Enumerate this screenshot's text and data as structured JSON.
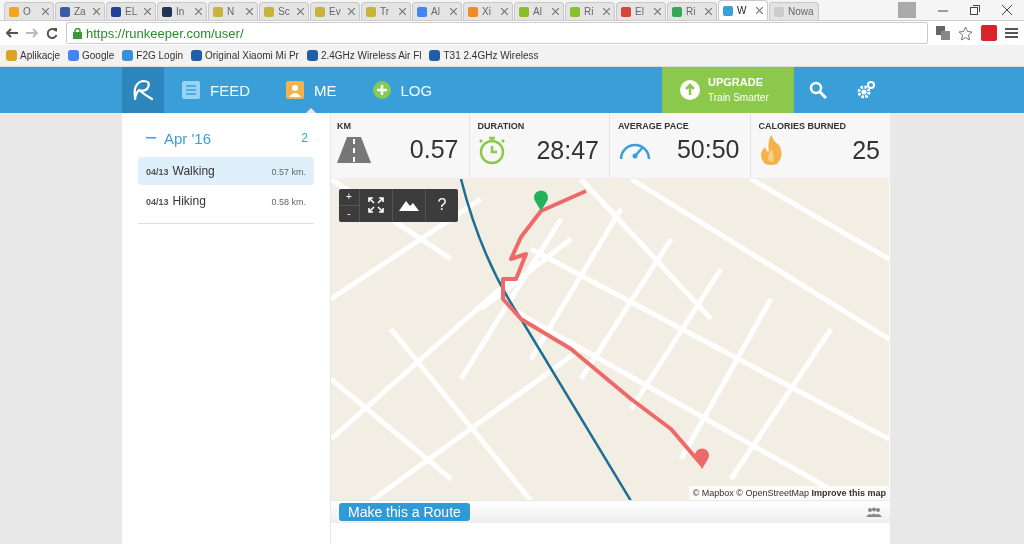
{
  "browser": {
    "tabs": [
      {
        "title": "O",
        "color": "#f4a323",
        "selected": false
      },
      {
        "title": "Za",
        "color": "#3b5ba9",
        "selected": false
      },
      {
        "title": "EL",
        "color": "#1f3f9a",
        "selected": false
      },
      {
        "title": "In",
        "color": "#223355",
        "selected": false
      },
      {
        "title": "N",
        "color": "#c8b43a",
        "selected": false
      },
      {
        "title": "Sc",
        "color": "#c8b43a",
        "selected": false
      },
      {
        "title": "Ev",
        "color": "#c8b43a",
        "selected": false
      },
      {
        "title": "Tr",
        "color": "#c8b43a",
        "selected": false
      },
      {
        "title": "Al",
        "color": "#4285f4",
        "selected": false
      },
      {
        "title": "Xi",
        "color": "#f08a24",
        "selected": false
      },
      {
        "title": "Al",
        "color": "#8bbf2a",
        "selected": false
      },
      {
        "title": "Ri",
        "color": "#8bbf2a",
        "selected": false
      },
      {
        "title": "El",
        "color": "#d44638",
        "selected": false
      },
      {
        "title": "Ri",
        "color": "#34a853",
        "selected": false
      },
      {
        "title": "W",
        "color": "#3a9fd8",
        "selected": true
      },
      {
        "title": "Nowa",
        "color": "#cccccc",
        "selected": false
      }
    ],
    "url": "https://runkeeper.com/user/",
    "bookmarks": [
      {
        "label": "Aplikacje",
        "color": "#e0a020"
      },
      {
        "label": "Google",
        "color": "#4285f4"
      },
      {
        "label": "F2G Login",
        "color": "#3a8fd8"
      },
      {
        "label": "Original Xiaomi Mi Pr",
        "color": "#1e5fa8"
      },
      {
        "label": "2.4GHz Wireless Air Fl",
        "color": "#1e5fa8"
      },
      {
        "label": "T31 2.4GHz Wireless",
        "color": "#1e5fa8"
      }
    ]
  },
  "nav": {
    "items": [
      {
        "label": "FEED",
        "kind": "feed",
        "selected": false
      },
      {
        "label": "ME",
        "kind": "me",
        "selected": true
      },
      {
        "label": "LOG",
        "kind": "log",
        "selected": false
      }
    ],
    "upgrade": {
      "title": "UPGRADE",
      "subtitle": "Train Smarter"
    }
  },
  "sidebar": {
    "month": "Apr '16",
    "count": "2",
    "activities": [
      {
        "date": "04/13",
        "name": "Walking",
        "distance": "0.57 km.",
        "selected": true
      },
      {
        "date": "04/13",
        "name": "Hiking",
        "distance": "0.58 km.",
        "selected": false
      }
    ]
  },
  "stats": [
    {
      "label": "KM",
      "value": "0.57",
      "kind": "road"
    },
    {
      "label": "DURATION",
      "value": "28:47",
      "kind": "stopwatch"
    },
    {
      "label": "AVERAGE PACE",
      "value": "50:50",
      "kind": "speedometer"
    },
    {
      "label": "CALORIES BURNED",
      "value": "25",
      "kind": "flame"
    }
  ],
  "map": {
    "zoom_in": "+",
    "zoom_out": "-",
    "help": "?",
    "attribution": "© Mapbox © OpenStreetMap",
    "improve_link": "Improve this map"
  },
  "route_button": "Make this a Route"
}
